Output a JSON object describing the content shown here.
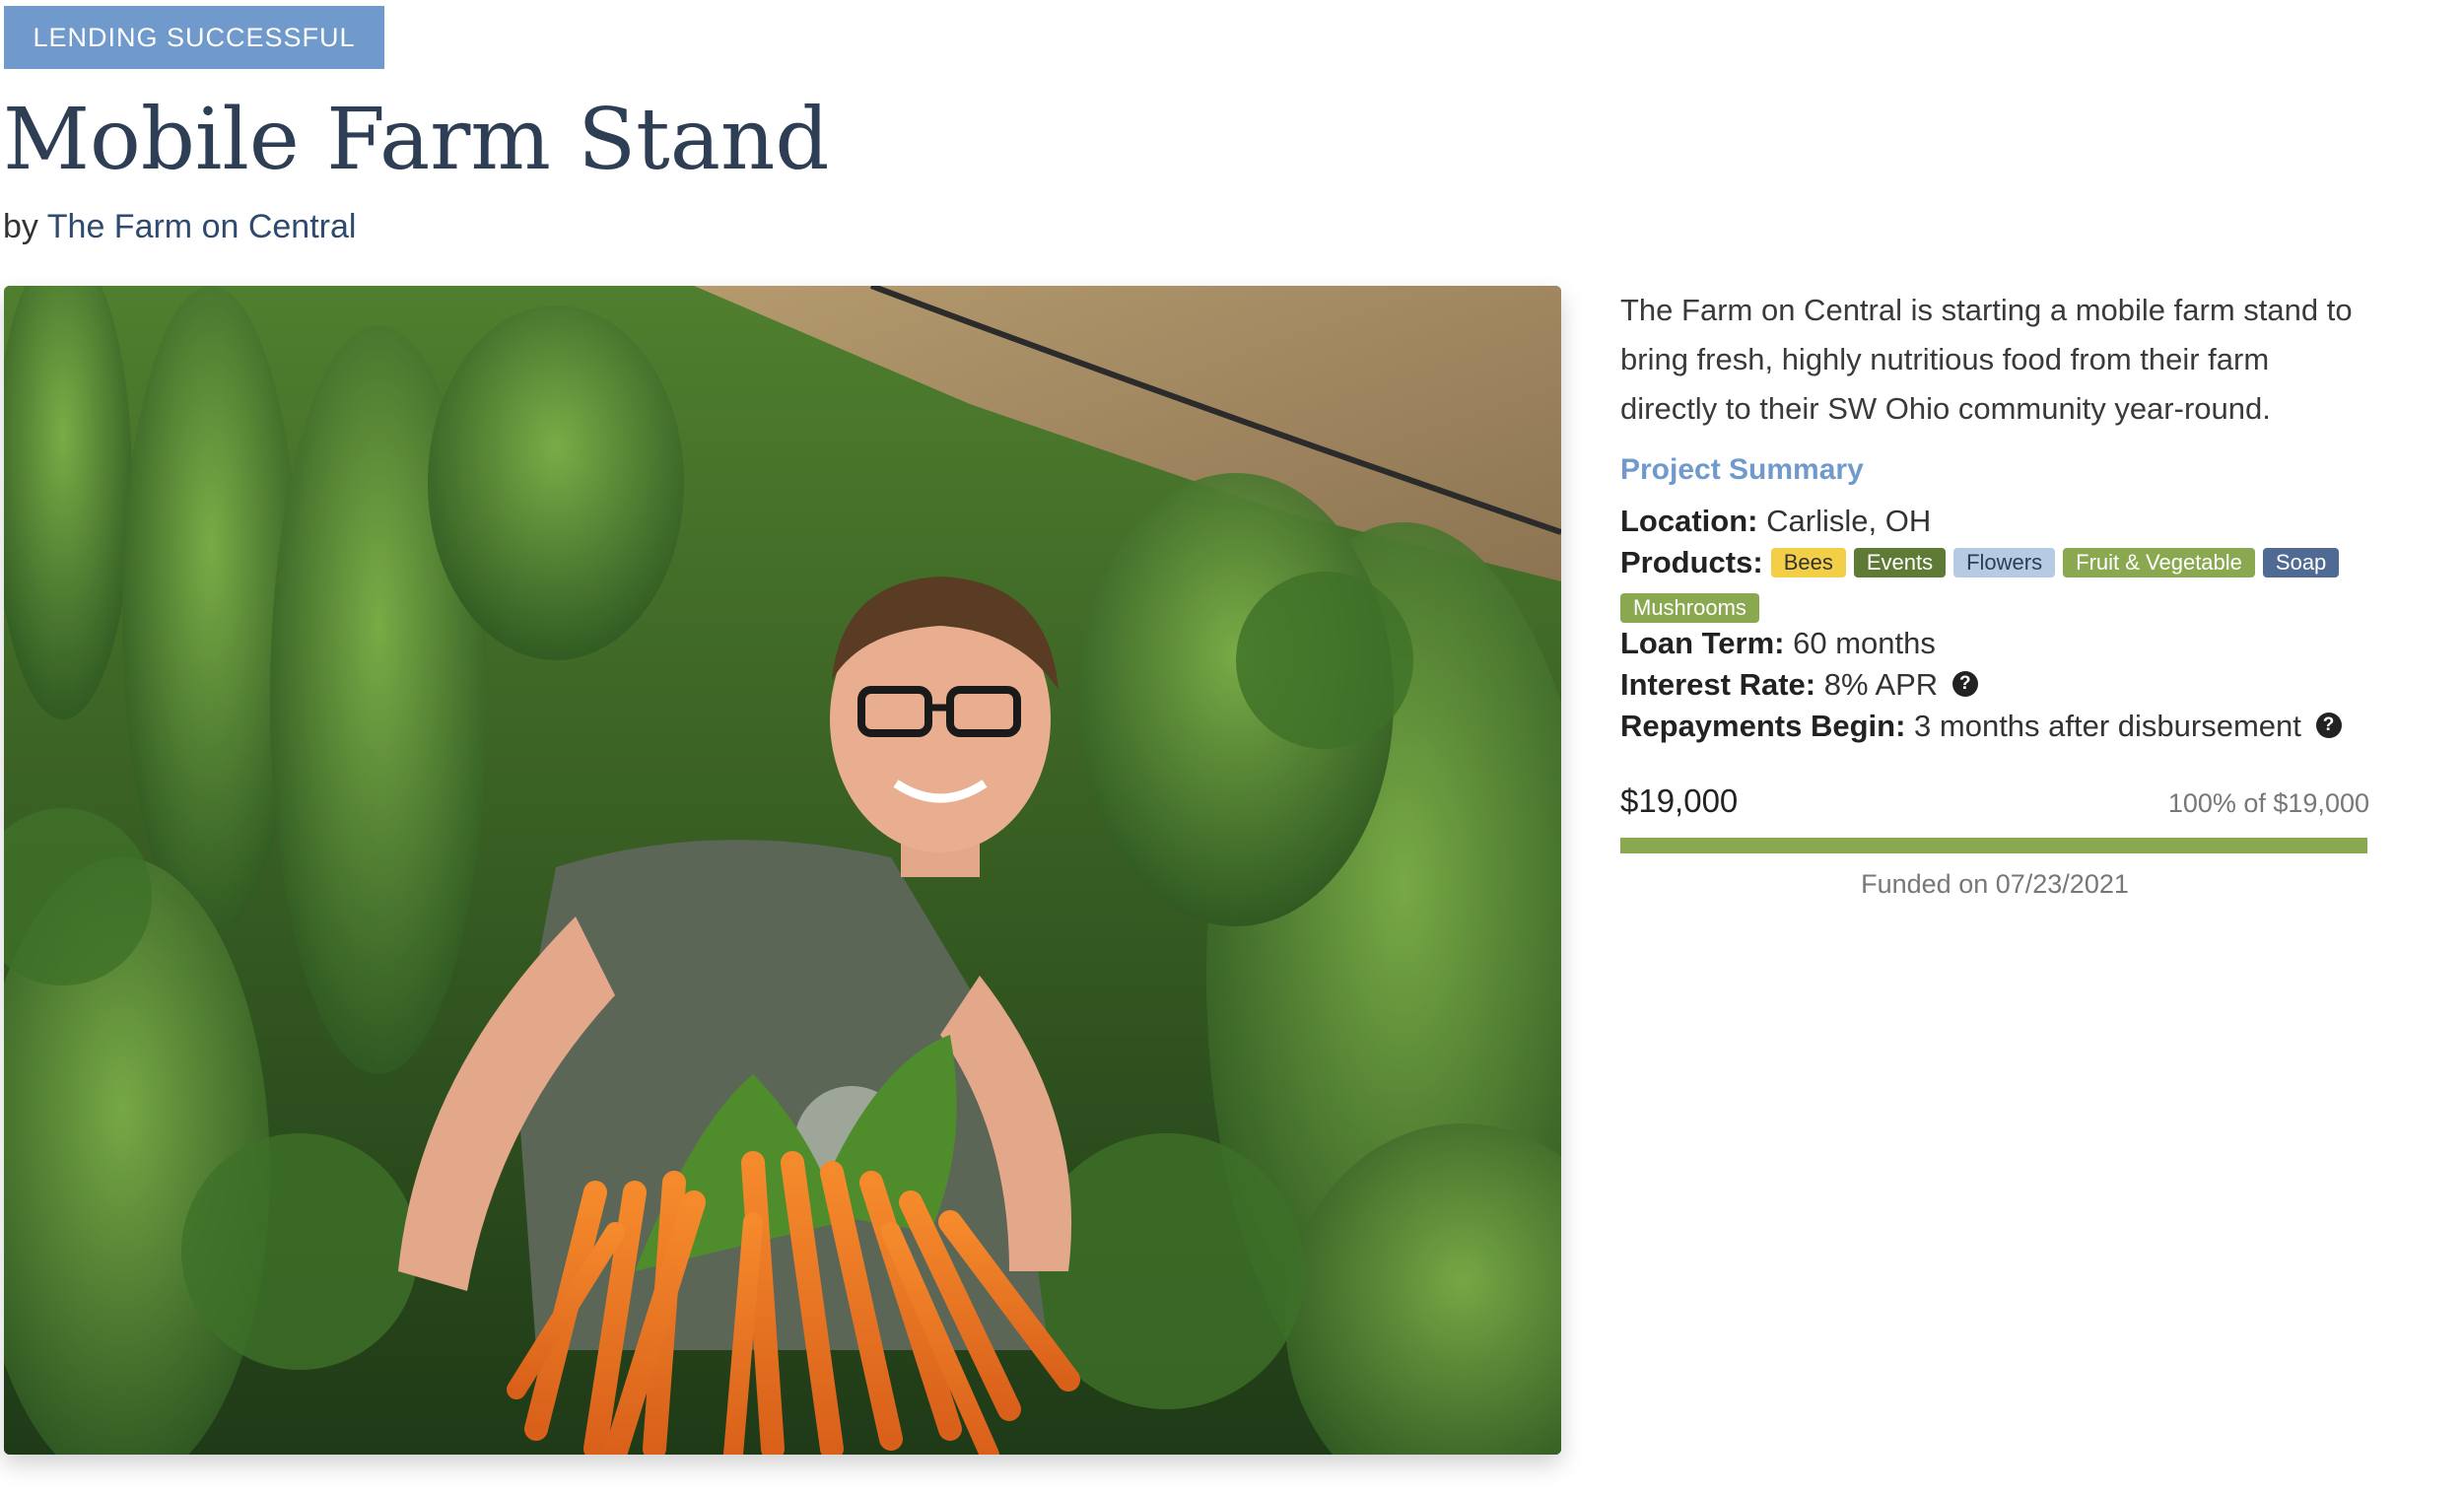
{
  "status_badge": "LENDING SUCCESSFUL",
  "title": "Mobile Farm Stand",
  "byline": {
    "prefix": "by",
    "author": "The Farm on Central"
  },
  "description": "The Farm on Central is starting a mobile farm stand to bring fresh, highly nutritious food from their farm directly to their SW Ohio community year-round.",
  "project_summary": {
    "heading": "Project Summary",
    "location_label": "Location:",
    "location": "Carlisle, OH",
    "products_label": "Products:",
    "products": [
      {
        "label": "Bees",
        "bg": "#f3cf47",
        "fg": "#333333"
      },
      {
        "label": "Events",
        "bg": "#5f7a35",
        "fg": "#ffffff"
      },
      {
        "label": "Flowers",
        "bg": "#b5cbe3",
        "fg": "#2e3e55"
      },
      {
        "label": "Fruit & Vegetable",
        "bg": "#8aa84f",
        "fg": "#ffffff"
      },
      {
        "label": "Soap",
        "bg": "#4f6b93",
        "fg": "#ffffff"
      },
      {
        "label": "Mushrooms",
        "bg": "#8aa84f",
        "fg": "#ffffff"
      }
    ],
    "loan_term_label": "Loan Term:",
    "loan_term": "60 months",
    "interest_rate_label": "Interest Rate:",
    "interest_rate": "8% APR",
    "repayments_label": "Repayments Begin:",
    "repayments": "3 months after disbursement"
  },
  "funding": {
    "amount": "$19,000",
    "percent_text": "100% of $19,000",
    "progress_fraction": 1.0,
    "funded_text": "Funded on 07/23/2021"
  },
  "colors": {
    "accent_blue": "#6f9acb",
    "title_navy": "#2e3e55",
    "progress_green": "#8aa84f"
  },
  "icons": {
    "help": "question-circle-icon"
  }
}
